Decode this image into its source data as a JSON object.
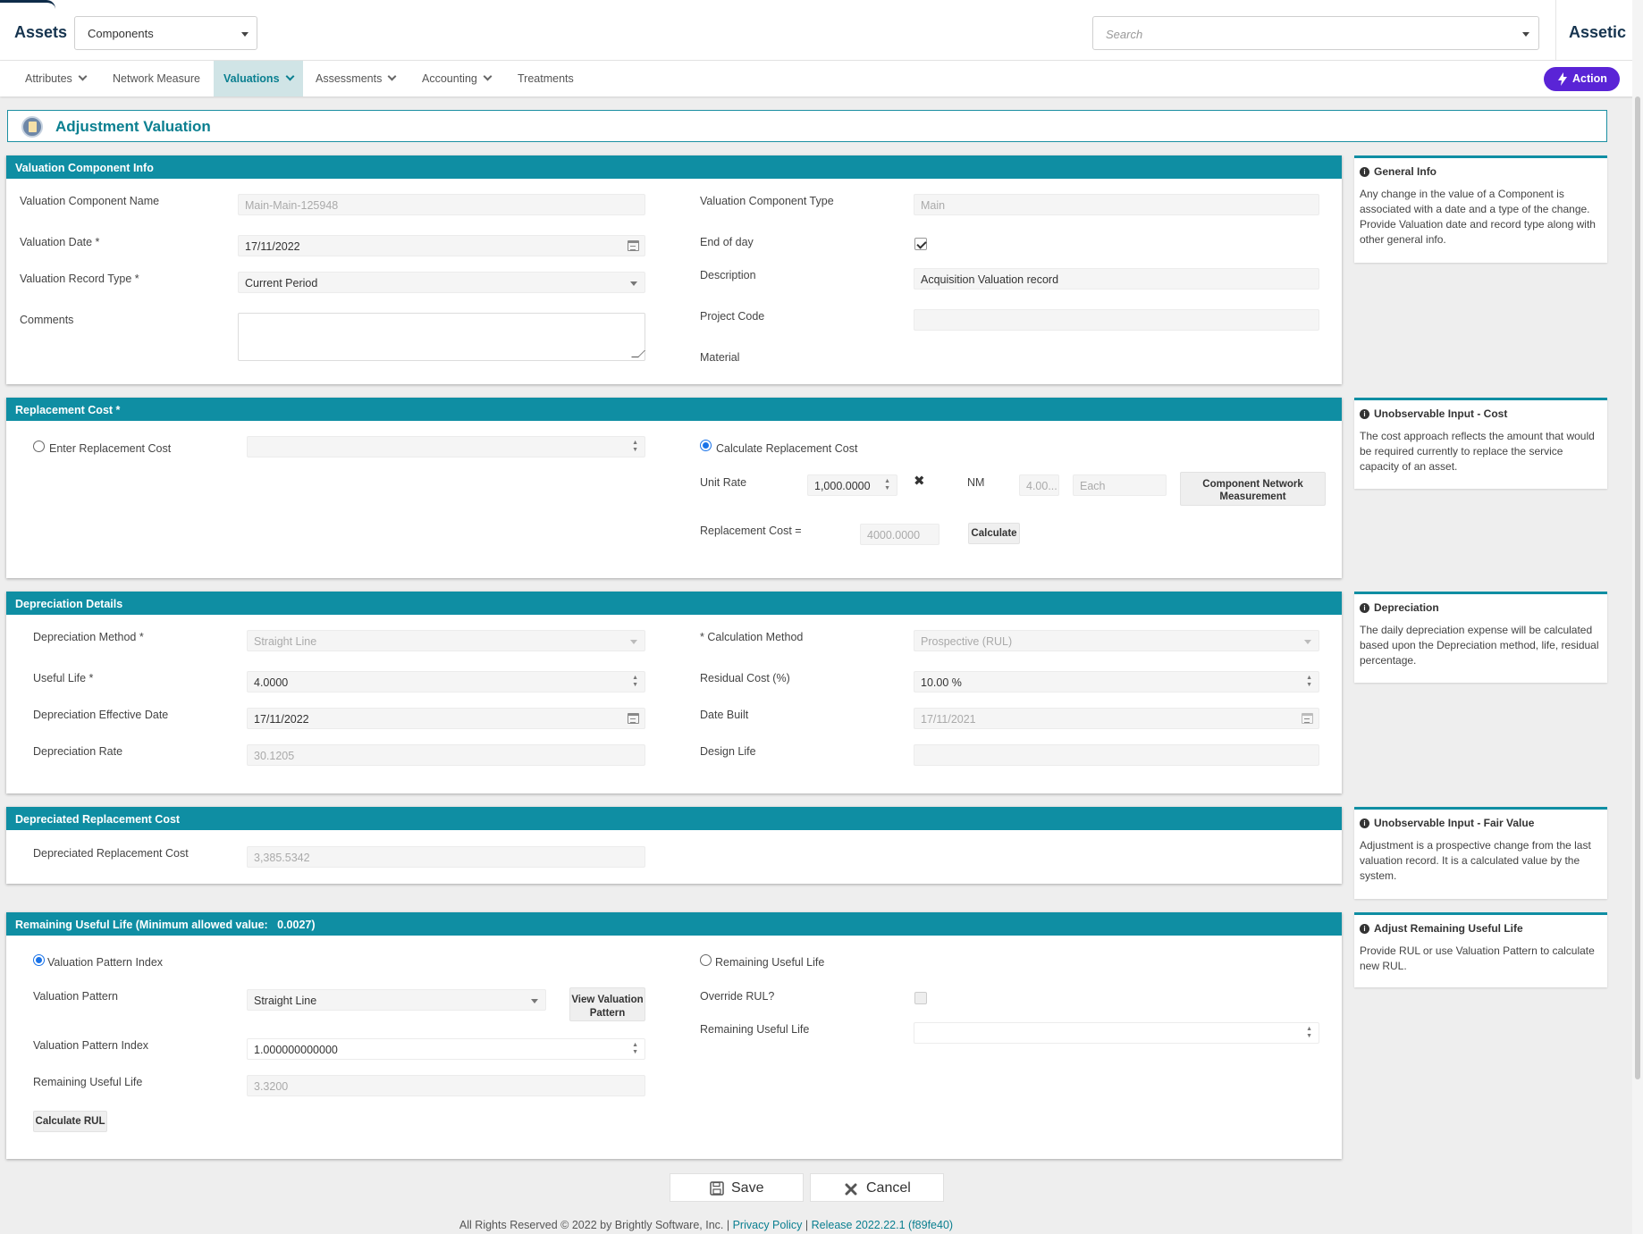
{
  "header": {
    "brand": "Assets",
    "module_select": "Components",
    "search_placeholder": "Search",
    "app_name": "Assetic"
  },
  "nav": {
    "tabs": [
      {
        "label": "Attributes",
        "dropdown": true
      },
      {
        "label": "Network Measure",
        "dropdown": false
      },
      {
        "label": "Valuations",
        "dropdown": true,
        "active": true
      },
      {
        "label": "Assessments",
        "dropdown": true
      },
      {
        "label": "Accounting",
        "dropdown": true
      },
      {
        "label": "Treatments",
        "dropdown": false
      }
    ],
    "action_label": "Action"
  },
  "page": {
    "title": "Adjustment Valuation"
  },
  "component_info": {
    "heading": "Valuation Component Info",
    "name_label": "Valuation Component Name",
    "name_value": "Main-Main-125948",
    "type_label": "Valuation Component Type",
    "type_value": "Main",
    "date_label": "Valuation Date *",
    "date_value": "17/11/2022",
    "eod_label": "End of day",
    "eod_checked": true,
    "record_type_label": "Valuation Record Type *",
    "record_type_value": "Current Period",
    "description_label": "Description",
    "description_value": "Acquisition Valuation record",
    "comments_label": "Comments",
    "comments_value": "",
    "project_code_label": "Project Code",
    "project_code_value": "",
    "material_label": "Material"
  },
  "replacement_cost": {
    "heading": "Replacement Cost *",
    "enter_label": "Enter Replacement Cost",
    "enter_value": "",
    "calculate_label": "Calculate Replacement Cost",
    "unit_rate_label": "Unit Rate",
    "unit_rate_value": "1,000.0000",
    "times_symbol": "✖",
    "nm_label": "NM",
    "nm_value": "4.00...",
    "unit_value": "Each",
    "component_network_btn": "Component Network Measurement",
    "replacement_cost_label": "Replacement Cost =",
    "replacement_cost_value": "4000.0000",
    "calculate_btn": "Calculate",
    "selected": "calculate"
  },
  "depreciation": {
    "heading": "Depreciation Details",
    "method_label": "Depreciation Method *",
    "method_value": "Straight Line",
    "calc_method_label": "* Calculation Method",
    "calc_method_value": "Prospective (RUL)",
    "useful_life_label": "Useful Life *",
    "useful_life_value": "4.0000",
    "residual_label": "Residual Cost (%)",
    "residual_value": "10.00 %",
    "effective_date_label": "Depreciation Effective Date",
    "effective_date_value": "17/11/2022",
    "date_built_label": "Date Built",
    "date_built_value": "17/11/2021",
    "rate_label": "Depreciation Rate",
    "rate_value": "30.1205",
    "design_life_label": "Design Life",
    "design_life_value": ""
  },
  "drc": {
    "heading": "Depreciated Replacement Cost",
    "label": "Depreciated Replacement Cost",
    "value": "3,385.5342"
  },
  "rul": {
    "heading": "Remaining Useful Life (Minimum allowed value:",
    "heading_min": "0.0027)",
    "pattern_index_radio": "Valuation Pattern Index",
    "rul_radio": "Remaining Useful Life",
    "selected": "pattern_index",
    "pattern_label": "Valuation Pattern",
    "pattern_value": "Straight Line",
    "view_pattern_btn": "View Valuation Pattern",
    "override_label": "Override RUL?",
    "override_checked": false,
    "rul_right_label": "Remaining Useful Life",
    "rul_right_value": "",
    "pattern_index_label": "Valuation Pattern Index",
    "pattern_index_value": "1.000000000000",
    "rul_left_label": "Remaining Useful Life",
    "rul_left_value": "3.3200",
    "calculate_rul_btn": "Calculate RUL"
  },
  "side_notes": [
    {
      "title": "General Info",
      "text": "Any change in the value of a Component is associated with a date and a type of the change. Provide Valuation date and record type along with other general info."
    },
    {
      "title": "Unobservable Input - Cost",
      "text": "The cost approach reflects the amount that would be required currently to replace the service capacity of an asset."
    },
    {
      "title": "Depreciation",
      "text": "The daily depreciation expense will be calculated based upon the Depreciation method, life, residual percentage."
    },
    {
      "title": "Unobservable Input - Fair Value",
      "text": "Adjustment is a prospective change from the last valuation record. It is a calculated value by the system."
    },
    {
      "title": "Adjust Remaining Useful Life",
      "text": "Provide RUL or use Valuation Pattern to calculate new RUL."
    }
  ],
  "footer": {
    "save_label": "Save",
    "cancel_label": "Cancel",
    "copyright": "All Rights Reserved © 2022 by Brightly Software, Inc. |",
    "privacy_link": "Privacy Policy",
    "separator": "|",
    "release_link": "Release 2022.22.1 (f89fe40)"
  },
  "colors": {
    "accent": "#0f8ea3",
    "action": "#5a24d6",
    "title": "#0a7f90"
  }
}
